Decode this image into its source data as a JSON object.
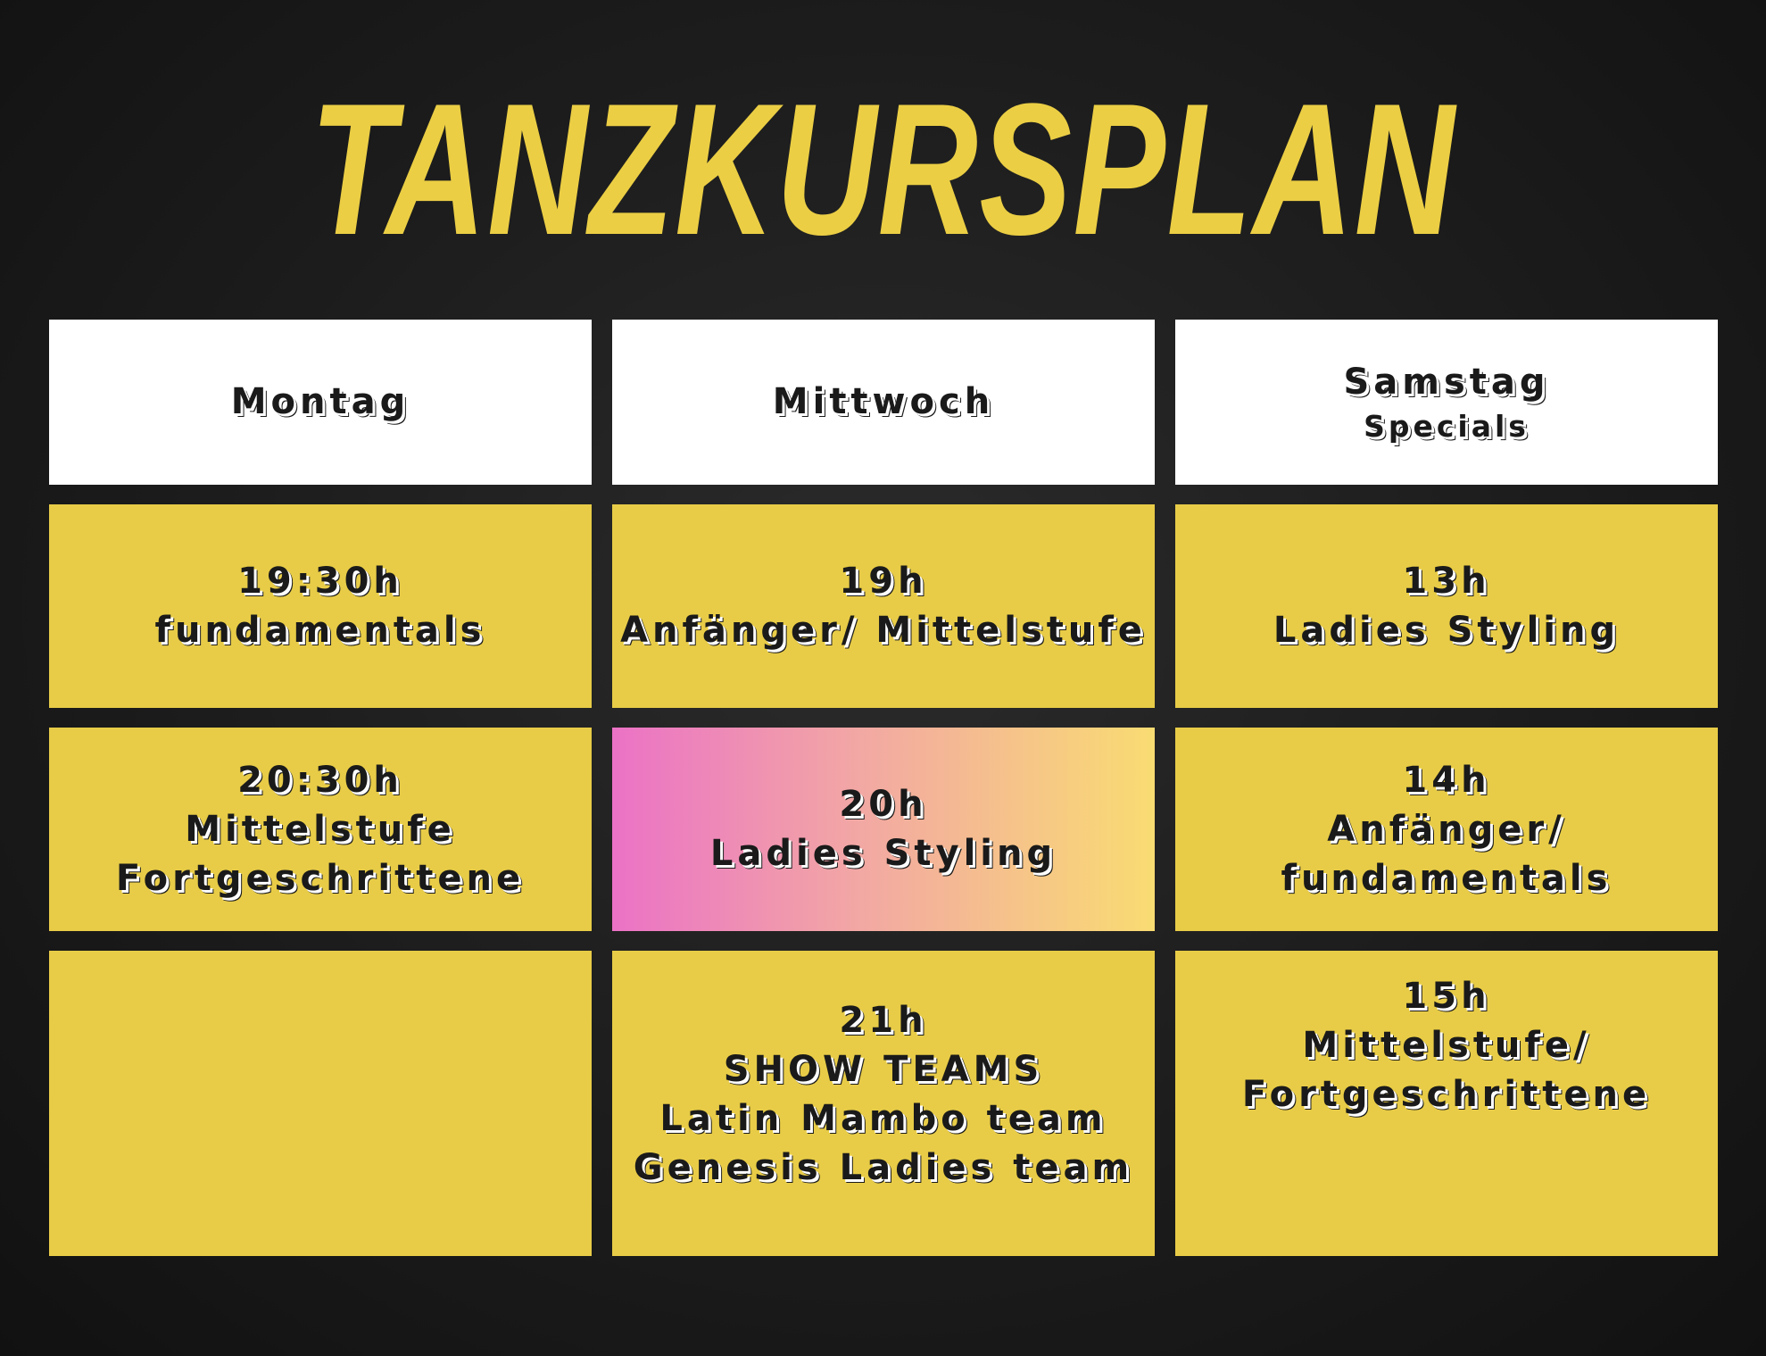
{
  "title": "TANZKURSPLAN",
  "colors": {
    "background": "#1c1c1c",
    "title": "#EBCE44",
    "cell": "#E8CC47",
    "header_cell": "#FFFFFF",
    "highlight_gradient_start": "#EB72C6",
    "highlight_gradient_end": "#F9DC72",
    "text": "#1a1a1a"
  },
  "headers": {
    "montag": "Montag",
    "mittwoch": "Mittwoch",
    "samstag": "Samstag",
    "samstag_sub": "Specials"
  },
  "montag": {
    "slot1": {
      "time": "19:30h",
      "line1": "fundamentals"
    },
    "slot2": {
      "time": "20:30h",
      "line1": "Mittelstufe",
      "line2": "Fortgeschrittene"
    }
  },
  "mittwoch": {
    "slot1": {
      "time": "19h",
      "line1": "Anfänger/ Mittelstufe"
    },
    "slot2": {
      "time": "20h",
      "line1": "Ladies Styling"
    },
    "slot3": {
      "time": "21h",
      "line1": "SHOW TEAMS",
      "line2": "Latin Mambo team",
      "line3": "Genesis Ladies team"
    }
  },
  "samstag": {
    "slot1": {
      "time": "13h",
      "line1": "Ladies Styling"
    },
    "slot2": {
      "time": "14h",
      "line1": "Anfänger/",
      "line2": "fundamentals"
    },
    "slot3": {
      "time": "15h",
      "line1": "Mittelstufe/",
      "line2": "Fortgeschrittene"
    }
  }
}
